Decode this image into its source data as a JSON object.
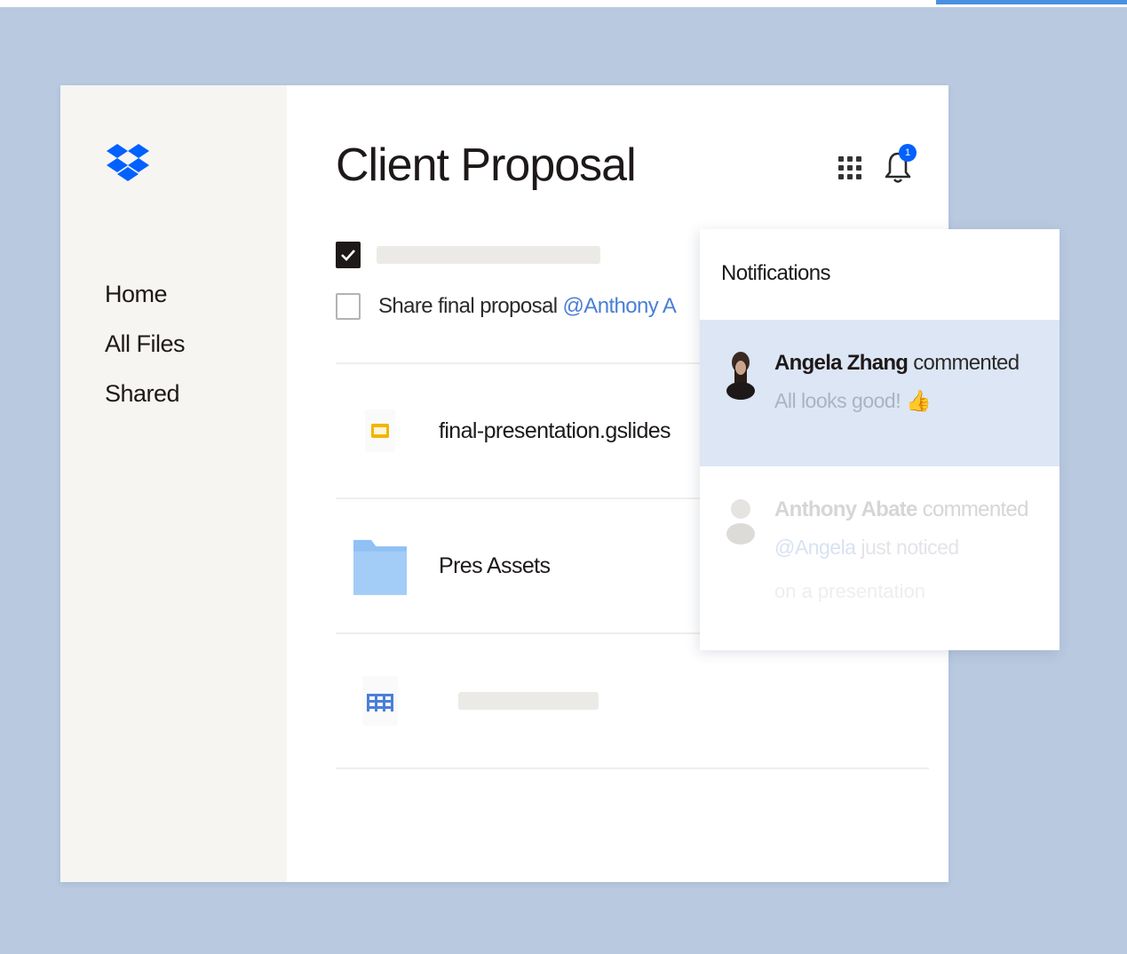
{
  "sidebar": {
    "nav": [
      "Home",
      "All Files",
      "Shared"
    ]
  },
  "main": {
    "title": "Client Proposal",
    "notification_count": "1",
    "tasks": [
      {
        "checked": true,
        "text": ""
      },
      {
        "checked": false,
        "text": "Share final proposal ",
        "mention": "@Anthony A"
      }
    ],
    "files": [
      {
        "name": "final-presentation.gslides",
        "icon": "slides-icon"
      },
      {
        "name": "Pres Assets",
        "icon": "folder-icon"
      },
      {
        "name": "",
        "icon": "sheet-icon"
      }
    ]
  },
  "notifications": {
    "header": "Notifications",
    "items": [
      {
        "author": "Angela Zhang",
        "action": " commented",
        "message": "All looks good! 👍"
      },
      {
        "author": "Anthony Abate",
        "action": " commented",
        "mention": "@Angela",
        "message": " just noticed",
        "extra": "on a presentation"
      }
    ]
  },
  "colors": {
    "background": "#b8c9e0",
    "brand_blue": "#0061fe",
    "active_notification": "#dce6f5",
    "folder_blue": "#8fc1f5",
    "slides_yellow": "#f4b400"
  }
}
